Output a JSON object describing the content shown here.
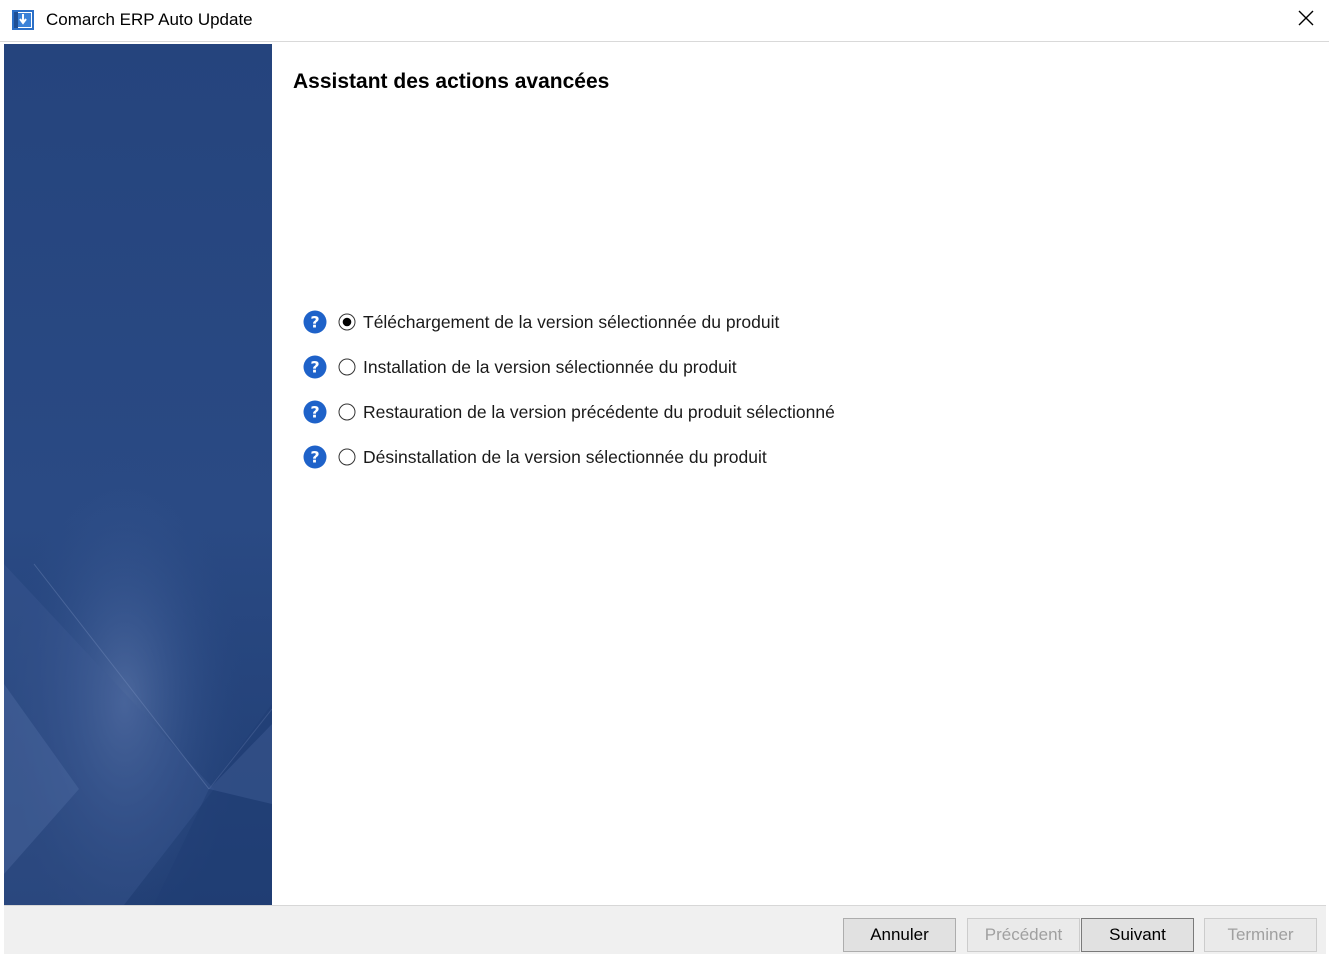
{
  "window": {
    "title": "Comarch ERP Auto Update"
  },
  "main": {
    "title": "Assistant des actions avancées",
    "options": [
      {
        "label": "Téléchargement de la version sélectionnée du produit",
        "selected": true
      },
      {
        "label": "Installation de la version sélectionnée du produit",
        "selected": false
      },
      {
        "label": "Restauration de la version précédente du produit sélectionné",
        "selected": false
      },
      {
        "label": "Désinstallation de la version sélectionnée du produit",
        "selected": false
      }
    ]
  },
  "footer": {
    "cancel_label": "Annuler",
    "previous_label": "Précédent",
    "next_label": "Suivant",
    "finish_label": "Terminer",
    "previous_enabled": false,
    "next_enabled": true,
    "finish_enabled": false
  },
  "icons": {
    "app": "app-update-icon",
    "close": "close-icon",
    "help": "help-question-icon"
  },
  "colors": {
    "sidebar": "#26457e",
    "help_icon": "#1e62c9",
    "disabled_text": "#a0a0a0"
  }
}
